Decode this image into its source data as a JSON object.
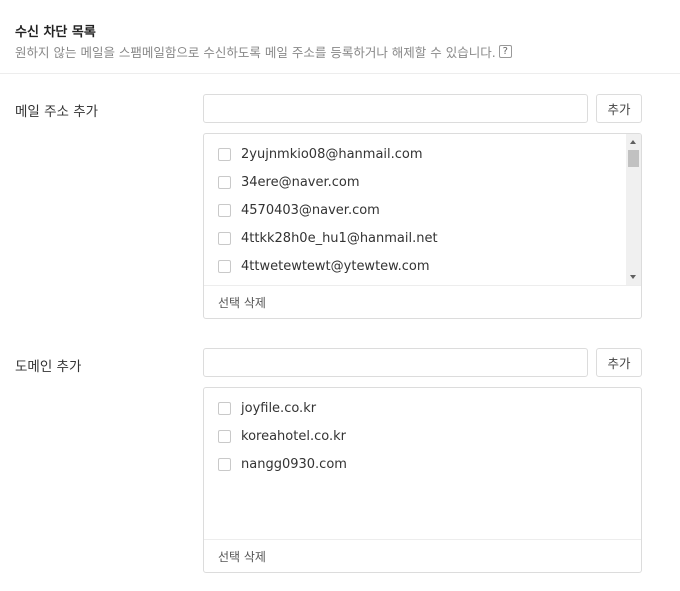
{
  "header": {
    "title": "수신 차단 목록",
    "description": "원하지 않는 메일을 스팸메일함으로 수신하도록 메일 주소를 등록하거나 해제할 수 있습니다.",
    "help_icon": "?"
  },
  "email_section": {
    "label": "메일 주소 추가",
    "input_value": "",
    "add_label": "추가",
    "items": [
      "2yujnmkio08@hanmail.com",
      "34ere@naver.com",
      "4570403@naver.com",
      "4ttkk28h0e_hu1@hanmail.net",
      "4ttwetewtewt@ytewtew.com"
    ],
    "delete_label": "선택 삭제"
  },
  "domain_section": {
    "label": "도메인 추가",
    "input_value": "",
    "add_label": "추가",
    "items": [
      "joyfile.co.kr",
      "koreahotel.co.kr",
      "nangg0930.com"
    ],
    "delete_label": "선택 삭제"
  }
}
